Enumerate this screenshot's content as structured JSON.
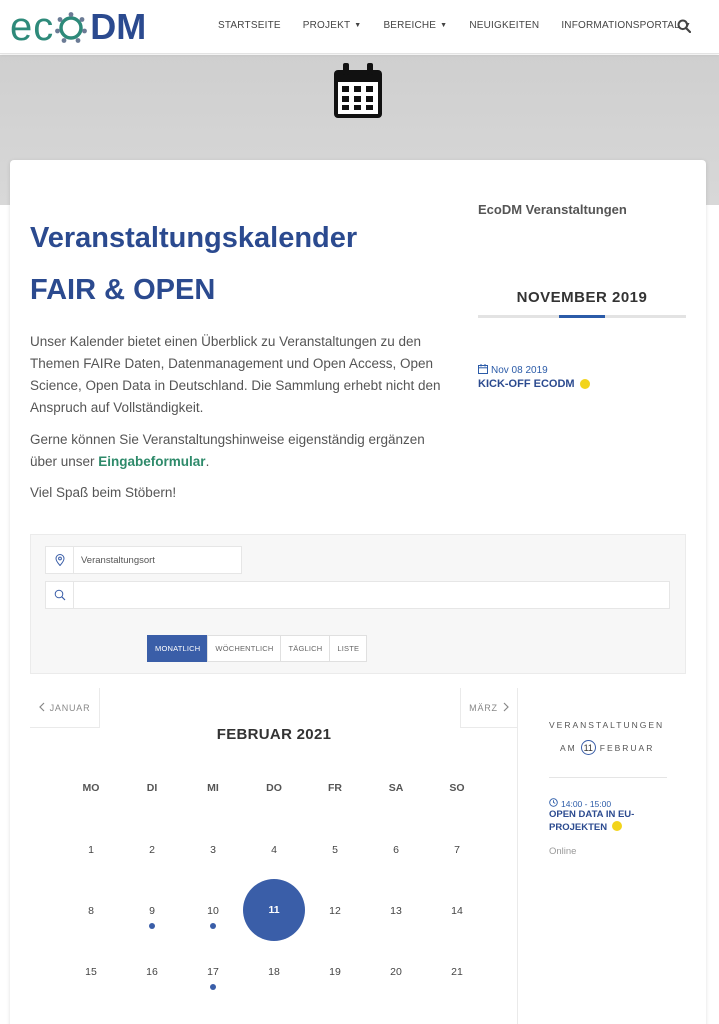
{
  "header": {
    "logo_eco": "ec",
    "logo_o": "O",
    "logo_dm": "DM",
    "nav": [
      {
        "label": "STARTSEITE",
        "dropdown": false
      },
      {
        "label": "PROJEKT",
        "dropdown": true
      },
      {
        "label": "BEREICHE",
        "dropdown": true
      },
      {
        "label": "NEUIGKEITEN",
        "dropdown": false
      },
      {
        "label": "INFORMATIONSPORTAL",
        "dropdown": true
      }
    ],
    "search_icon": "search-icon"
  },
  "hero": {
    "icon": "calendar-icon"
  },
  "main": {
    "title1": "Veranstaltungskalender",
    "title2": "FAIR & OPEN",
    "intro": "Unser Kalender bietet einen Überblick zu Veranstaltungen zu den Themen FAIRe Daten, Datenmanagement und Open Access, Open Science, Open Data in Deutschland. Die Sammlung erhebt nicht den Anspruch auf Vollständigkeit.",
    "p2_prefix": "Gerne können Sie Veranstaltungshinweise eigenständig ergänzen über unser ",
    "p2_link": "Eingabeformular",
    "p2_suffix": ".",
    "p3": "Viel Spaß beim Stöbern!"
  },
  "widget": {
    "title": "EcoDM Veranstaltungen",
    "month": "NOVEMBER 2019",
    "event_date": "Nov 08 2019",
    "event_title": "KICK-OFF ECODM",
    "event_color": "#f2d41b"
  },
  "filter": {
    "location_placeholder": "Veranstaltungsort",
    "search_placeholder": "",
    "views": [
      "MONATLICH",
      "WÖCHENTLICH",
      "TÄGLICH",
      "LISTE"
    ],
    "active_view": "MONATLICH"
  },
  "calendar": {
    "prev": "JANUAR",
    "next": "MÄRZ",
    "title": "FEBRUAR 2021",
    "weekdays": [
      "MO",
      "DI",
      "MI",
      "DO",
      "FR",
      "SA",
      "SO"
    ],
    "weeks": [
      [
        "1",
        "2",
        "3",
        "4",
        "5",
        "6",
        "7"
      ],
      [
        "8",
        "9",
        "10",
        "11",
        "12",
        "13",
        "14"
      ],
      [
        "15",
        "16",
        "17",
        "18",
        "19",
        "20",
        "21"
      ]
    ],
    "today": "11",
    "event_days": [
      "9",
      "10",
      "17"
    ]
  },
  "day_events": {
    "title": "VERANSTALTUNGEN",
    "am": "AM",
    "day": "11",
    "month": "FEBRUAR",
    "event_time": "14:00 - 15:00",
    "event_title": "OPEN DATA IN EU-PROJEKTEN",
    "event_location": "Online"
  }
}
